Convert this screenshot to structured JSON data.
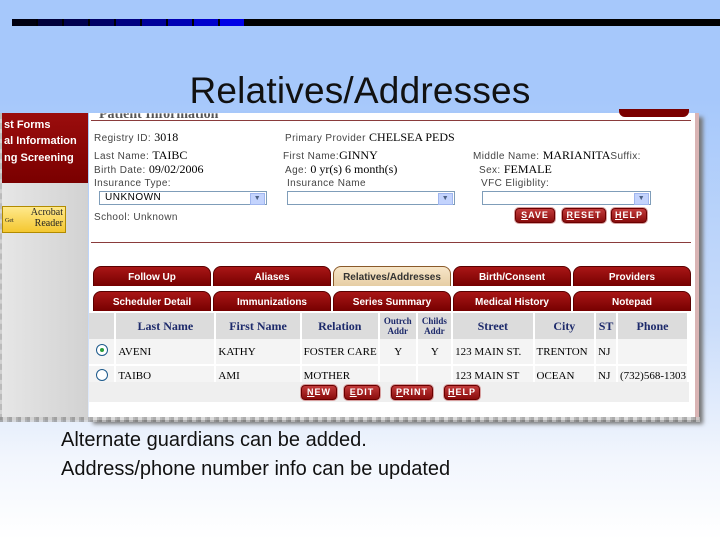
{
  "slide": {
    "title": "Relatives/Addresses",
    "captions": [
      "Alternate guardians can be added.",
      "Address/phone number info can be updated"
    ],
    "topbar_colors": [
      "#000010",
      "#00003a",
      "#00004e",
      "#000066",
      "#000080",
      "#000099",
      "#0000b3",
      "#0000cc",
      "#0000e6"
    ]
  },
  "nav": {
    "items": [
      "st Forms",
      "al Information",
      "ng Screening"
    ],
    "acrobat_prefix": "Get",
    "acrobat_line1": "Acrobat",
    "acrobat_line2": "Reader"
  },
  "patient": {
    "section_title": "Patient Information",
    "registry_label": "Registry ID:",
    "registry_value": "3018",
    "provider_label": "Primary Provider",
    "provider_value": "CHELSEA PEDS",
    "last_name_label": "Last Name:",
    "last_name_value": "TAIBC",
    "first_name_label": "First Name:",
    "first_name_value": "GINNY",
    "middle_name_label": "Middle Name:",
    "middle_name_value": "MARIANITA",
    "suffix_label": "Suffix:",
    "birth_label": "Birth Date:",
    "birth_value": "09/02/2006",
    "age_label": "Age:",
    "age_value": "0 yr(s) 6 month(s)",
    "sex_label": "Sex:",
    "sex_value": "FEMALE",
    "insurance_type_label": "Insurance Type:",
    "insurance_type_value": "UNKNOWN",
    "insurance_name_label": "Insurance Name",
    "insurance_name_value": "",
    "vfc_label": "VFC Eligiblity:",
    "vfc_value": "",
    "school_label": "School:",
    "school_value": "Unknown",
    "buttons": {
      "save": "SAVE",
      "reset": "RESET",
      "help": "HELP"
    }
  },
  "tabs": {
    "row1": [
      "Follow Up",
      "Aliases",
      "Relatives/Addresses",
      "Birth/Consent",
      "Providers"
    ],
    "row2": [
      "Scheduler Detail",
      "Immunizations",
      "Series Summary",
      "Medical History",
      "Notepad"
    ],
    "active": "Relatives/Addresses"
  },
  "relatives": {
    "columns": [
      "",
      "Last Name",
      "First Name",
      "Relation",
      "Outrch Addr",
      "Childs Addr",
      "Street",
      "City",
      "ST",
      "Phone"
    ],
    "rows": [
      {
        "selected": true,
        "last": "AVENI",
        "first": "KATHY",
        "relation": "FOSTER CARE",
        "outreach": "Y",
        "childs": "Y",
        "street": "123 MAIN ST.",
        "city": "TRENTON",
        "st": "NJ",
        "phone": ""
      },
      {
        "selected": false,
        "last": "TAIBO",
        "first": "AMI",
        "relation": "MOTHER",
        "outreach": "",
        "childs": "",
        "street": "123 MAIN ST",
        "city": "OCEAN",
        "st": "NJ",
        "phone": "(732)568-1303"
      }
    ],
    "buttons": {
      "new": "NEW",
      "edit": "EDIT",
      "print": "PRINT",
      "help": "HELP"
    }
  }
}
